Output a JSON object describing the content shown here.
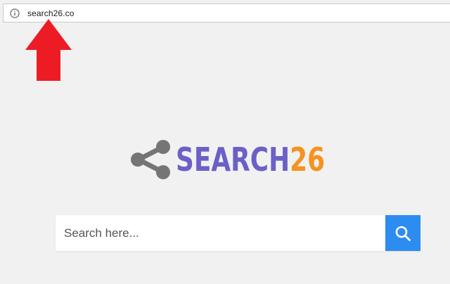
{
  "browser": {
    "url": "search26.co",
    "info_icon": "info-circle-icon"
  },
  "annotation": {
    "arrow_icon": "red-up-arrow-icon",
    "color": "#ed1c24"
  },
  "logo": {
    "icon": "share-icon",
    "text_main": "SEARCH",
    "text_number": "26",
    "main_color": "#6b60c8",
    "number_color": "#f6921e",
    "icon_color": "#757575"
  },
  "search": {
    "placeholder": "Search here...",
    "button_icon": "search-icon",
    "button_color": "#2d8cf0"
  }
}
